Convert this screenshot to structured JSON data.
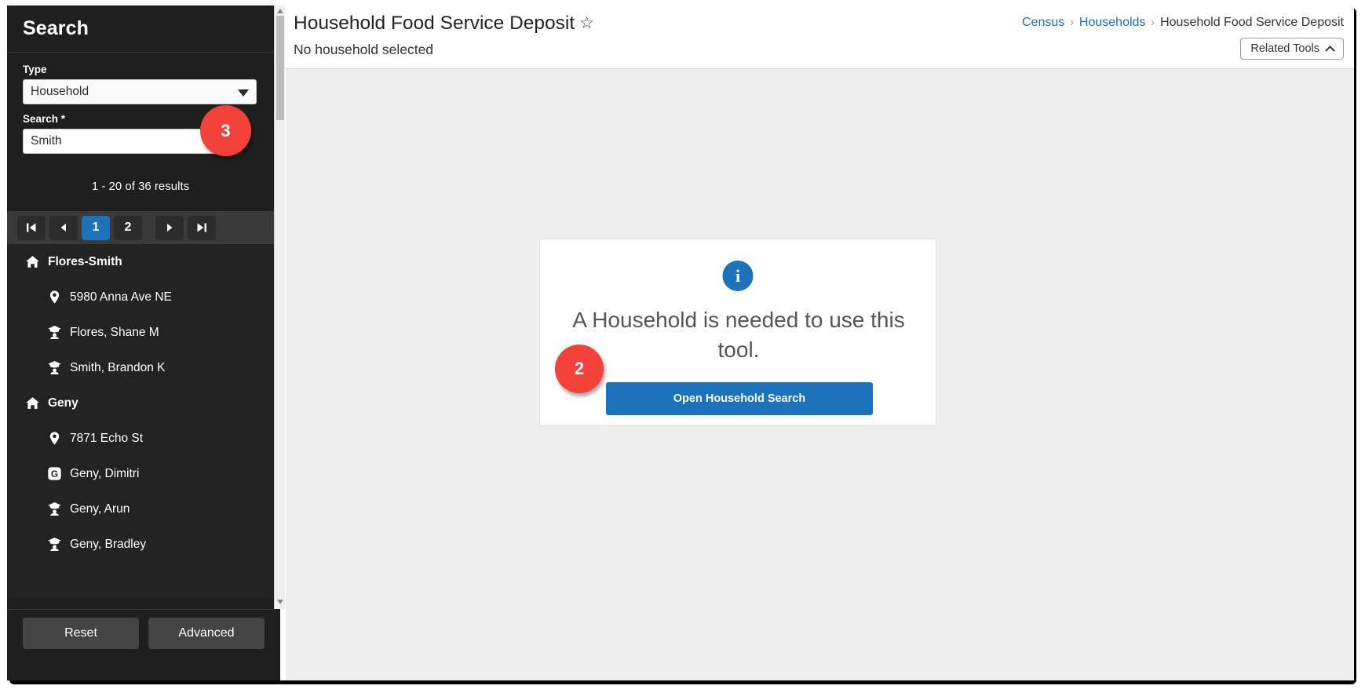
{
  "sidebar": {
    "title": "Search",
    "type_label": "Type",
    "type_value": "Household",
    "type_options": [
      "Household"
    ],
    "search_label": "Search *",
    "search_value": "Smith",
    "search_placeholder": "",
    "results_count": "1 - 20 of 36 results",
    "pagination": {
      "first_icon": "first-page-icon",
      "prev_icon": "previous-page-icon",
      "pages": [
        "1",
        "2"
      ],
      "active_page": "1",
      "next_icon": "next-page-icon",
      "last_icon": "last-page-icon"
    },
    "results": [
      {
        "icon": "home-icon",
        "label": "Flores-Smith",
        "type": "household"
      },
      {
        "icon": "location-icon",
        "label": "5980 Anna Ave NE",
        "type": "address"
      },
      {
        "icon": "student-icon",
        "label": "Flores, Shane M",
        "type": "person"
      },
      {
        "icon": "student-icon",
        "label": "Smith, Brandon K",
        "type": "person"
      },
      {
        "icon": "home-icon",
        "label": "Geny",
        "type": "household"
      },
      {
        "icon": "location-icon",
        "label": "7871 Echo St",
        "type": "address"
      },
      {
        "icon": "guardian-icon",
        "label": "Geny, Dimitri",
        "type": "person"
      },
      {
        "icon": "student-icon",
        "label": "Geny, Arun",
        "type": "person"
      },
      {
        "icon": "student-icon",
        "label": "Geny, Bradley",
        "type": "person"
      }
    ],
    "reset_label": "Reset",
    "advanced_label": "Advanced"
  },
  "header": {
    "tool_title": "Household Food Service Deposit",
    "favorite_icon": "star-outline-icon",
    "subtitle": "No household selected",
    "breadcrumb": {
      "item1": "Census",
      "item2": "Households",
      "current": "Household Food Service Deposit",
      "separator": "›"
    },
    "related_tools_label": "Related Tools",
    "related_tools_chevron": "chevron-up-icon"
  },
  "content": {
    "info_icon": "info-icon",
    "info_glyph": "i",
    "message": "A Household is needed to use this tool.",
    "open_search_label": "Open Household Search"
  },
  "callouts": [
    {
      "number": "2",
      "target": "open-household-search-button"
    },
    {
      "number": "3",
      "target": "search-input"
    }
  ],
  "colors": {
    "accent_blue": "#1c72bb",
    "callout_red": "#f4423a",
    "sidebar_bg": "#1f1f1f",
    "content_bg": "#eeeeee"
  }
}
